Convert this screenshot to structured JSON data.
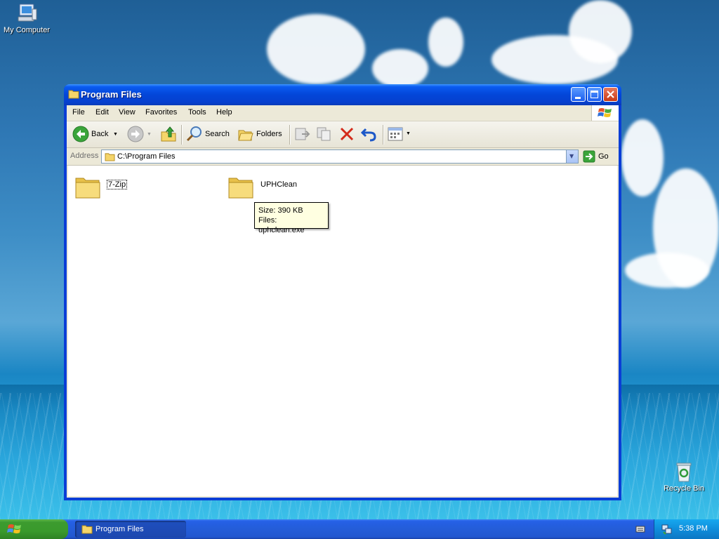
{
  "desktop": {
    "icons": [
      {
        "label": "My Computer"
      },
      {
        "label": "Recycle Bin"
      }
    ]
  },
  "window": {
    "title": "Program Files",
    "menu": [
      "File",
      "Edit",
      "View",
      "Favorites",
      "Tools",
      "Help"
    ],
    "toolbar": {
      "back_label": "Back",
      "search_label": "Search",
      "folders_label": "Folders"
    },
    "address": {
      "label": "Address",
      "value": "C:\\Program Files",
      "go_label": "Go"
    },
    "items": [
      {
        "name": "7-Zip"
      },
      {
        "name": "UPHClean"
      }
    ],
    "tooltip": {
      "line1": "Size: 390 KB",
      "line2": "Files: uphclean.exe"
    }
  },
  "taskbar": {
    "task_label": "Program Files",
    "clock": "5:38 PM"
  }
}
